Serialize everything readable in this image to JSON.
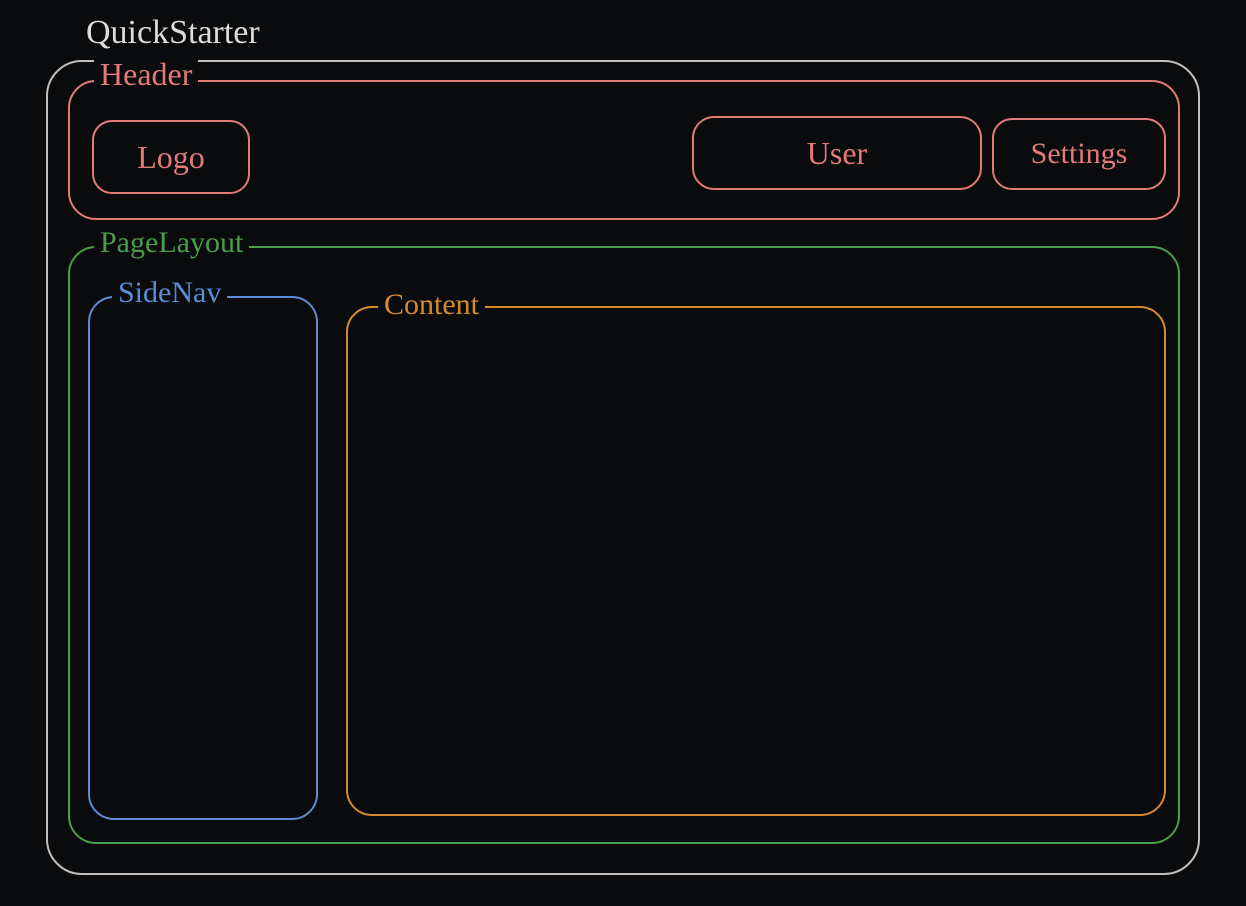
{
  "app": {
    "title": "QuickStarter"
  },
  "header": {
    "label": "Header",
    "logo_label": "Logo",
    "user_label": "User",
    "settings_label": "Settings"
  },
  "page_layout": {
    "label": "PageLayout",
    "sidenav_label": "SideNav",
    "content_label": "Content"
  },
  "colors": {
    "background": "#0a0b0d",
    "outer_border": "#bfbfbf",
    "header": "#e27a7a",
    "page_layout": "#4a9d4a",
    "sidenav": "#5a8dd6",
    "content": "#d68a2e",
    "title": "#dcdcdc"
  }
}
